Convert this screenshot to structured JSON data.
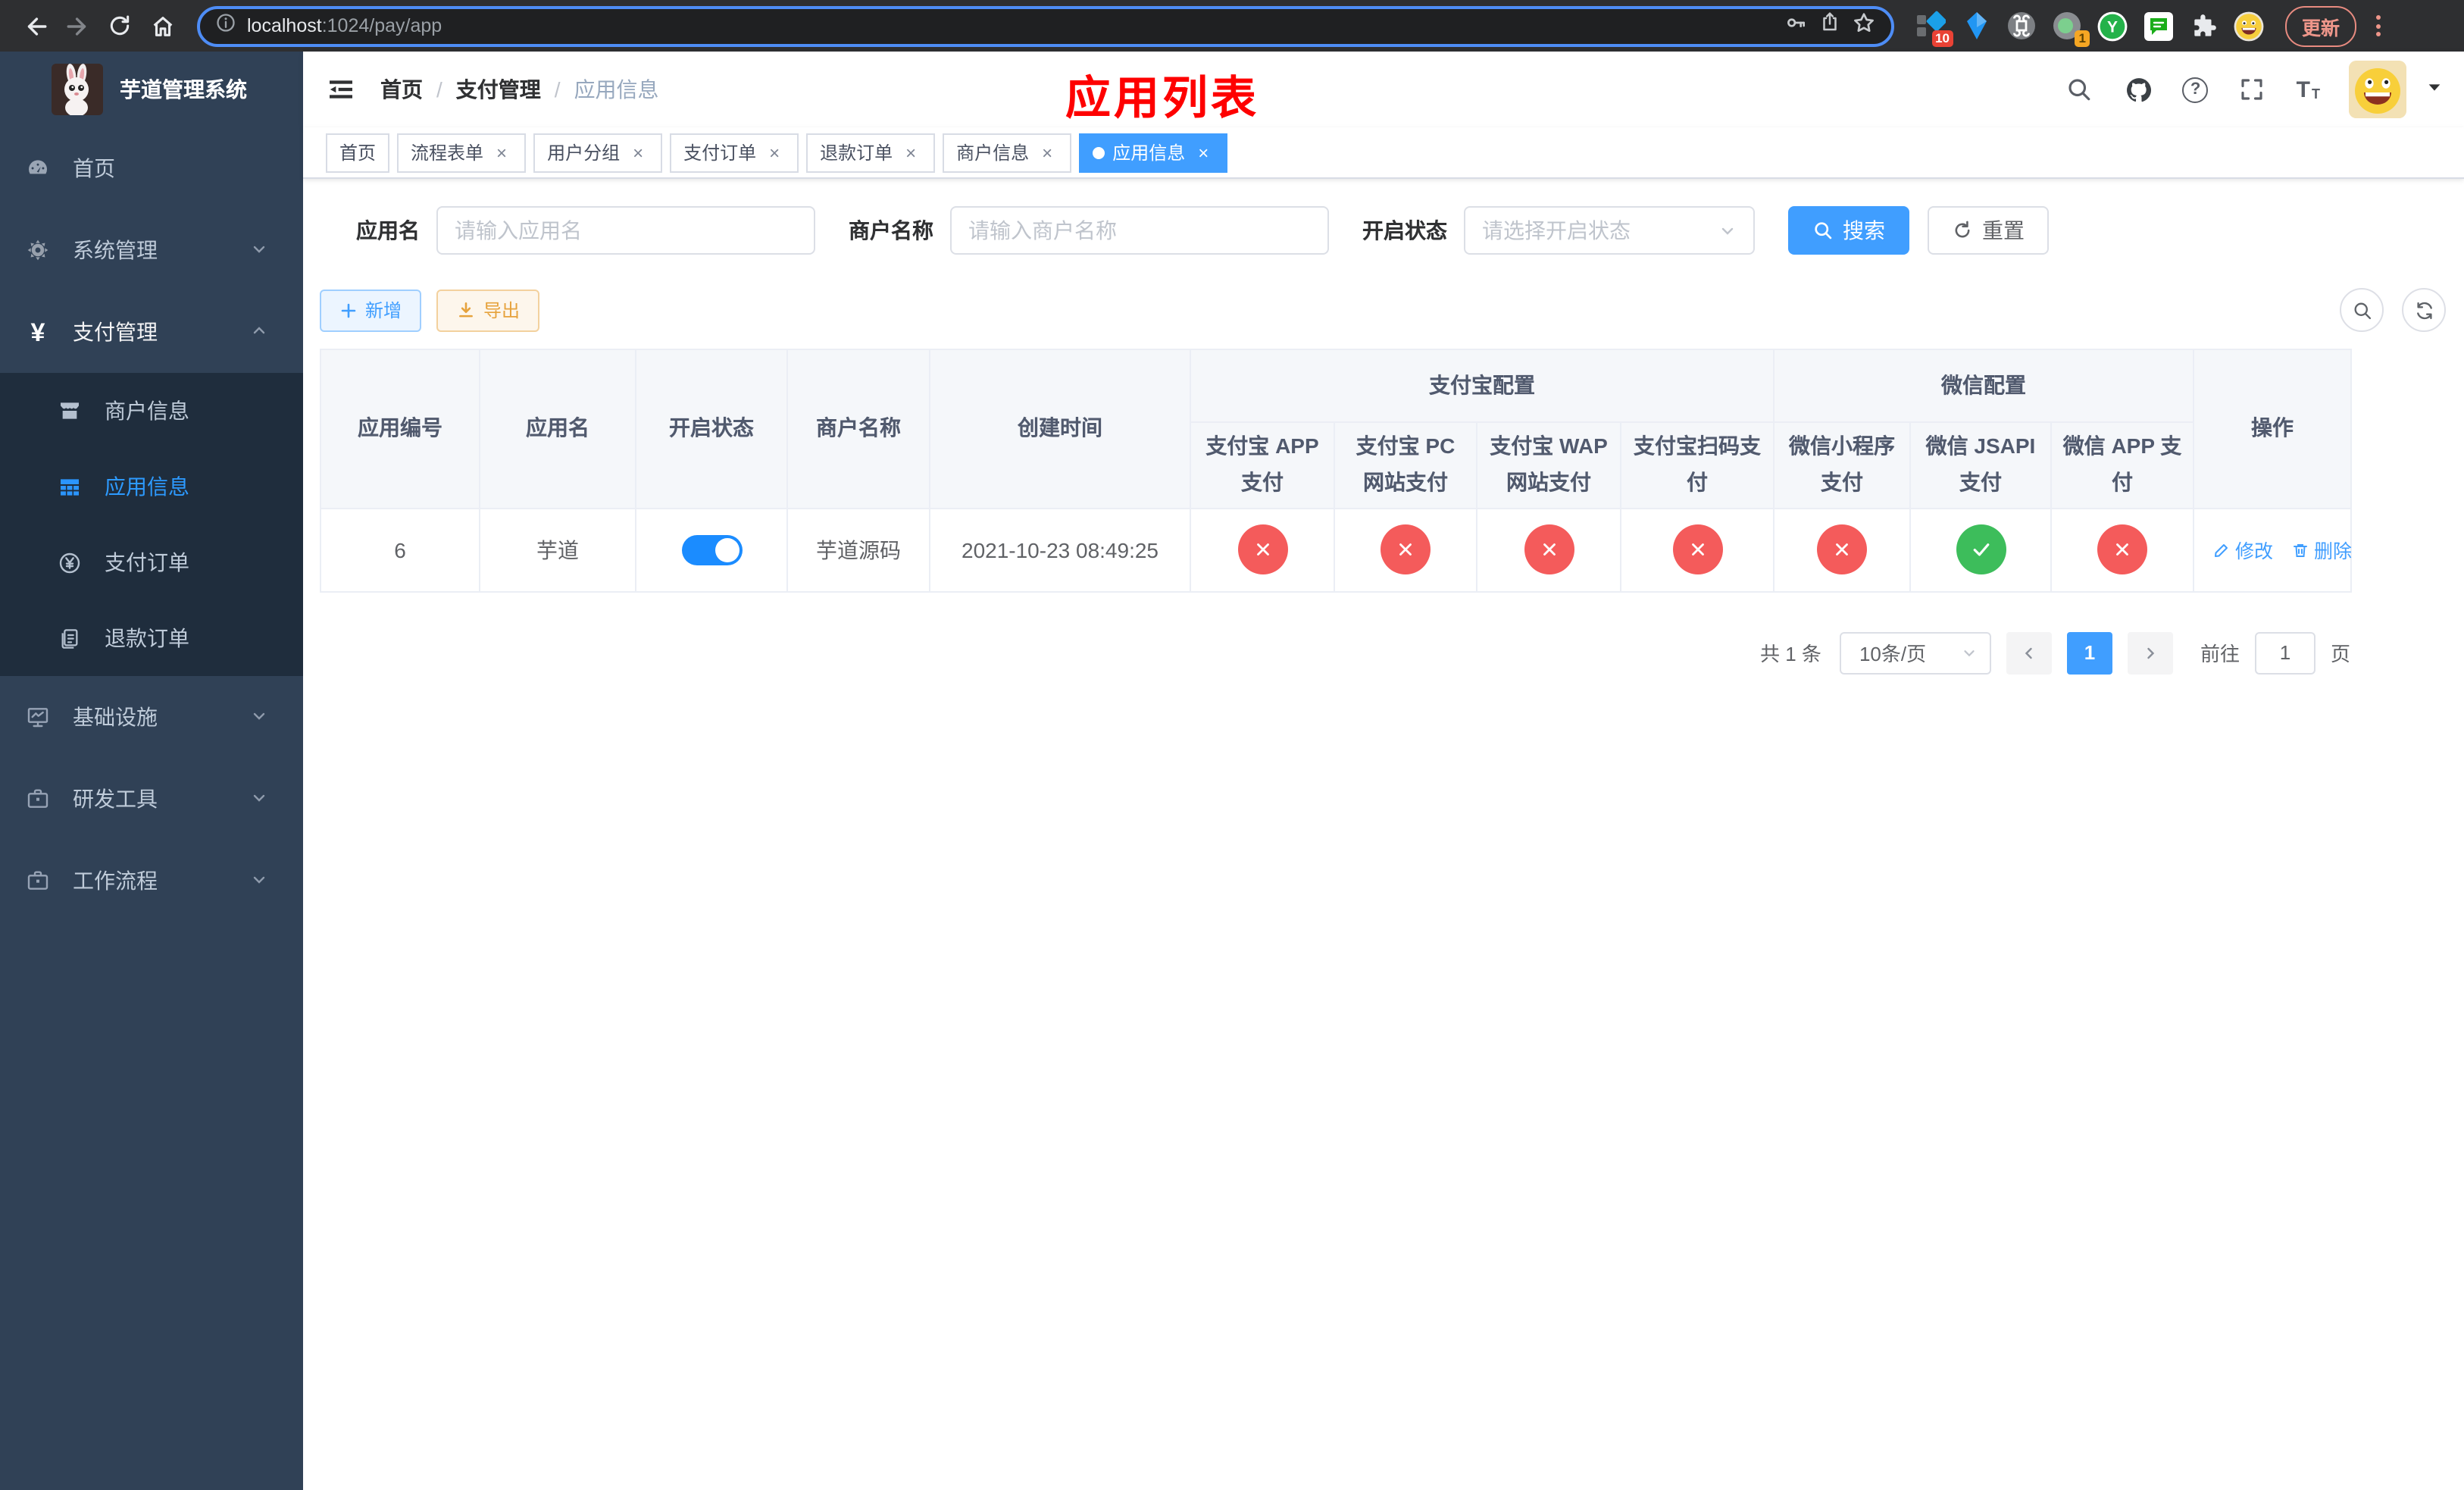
{
  "browser": {
    "url_host": "localhost",
    "url_rest": ":1024/pay/app",
    "update_label": "更新",
    "badges": {
      "tampermonkey": "10",
      "proxy": "1"
    }
  },
  "sidebar": {
    "title": "芋道管理系统",
    "menu": [
      {
        "label": "首页"
      },
      {
        "label": "系统管理"
      },
      {
        "label": "支付管理"
      },
      {
        "label": "基础设施"
      },
      {
        "label": "研发工具"
      },
      {
        "label": "工作流程"
      }
    ],
    "submenu": [
      {
        "label": "商户信息"
      },
      {
        "label": "应用信息"
      },
      {
        "label": "支付订单"
      },
      {
        "label": "退款订单"
      }
    ]
  },
  "navbar": {
    "breadcrumb": {
      "home": "首页",
      "sep": "/",
      "section": "支付管理",
      "current": "应用信息"
    }
  },
  "overlay_title": "应用列表",
  "tabs": [
    {
      "label": "首页"
    },
    {
      "label": "流程表单"
    },
    {
      "label": "用户分组"
    },
    {
      "label": "支付订单"
    },
    {
      "label": "退款订单"
    },
    {
      "label": "商户信息"
    },
    {
      "label": "应用信息"
    }
  ],
  "filters": {
    "app_name_label": "应用名",
    "app_name_placeholder": "请输入应用名",
    "merchant_label": "商户名称",
    "merchant_placeholder": "请输入商户名称",
    "status_label": "开启状态",
    "status_placeholder": "请选择开启状态",
    "search_label": "搜索",
    "reset_label": "重置"
  },
  "toolbar": {
    "add_label": "新增",
    "export_label": "导出"
  },
  "table": {
    "col_id": "应用编号",
    "col_name": "应用名",
    "col_status": "开启状态",
    "col_merchant": "商户名称",
    "col_created": "创建时间",
    "group_alipay": "支付宝配置",
    "group_wechat": "微信配置",
    "col_actions": "操作",
    "sub_cols": [
      "支付宝 APP 支付",
      "支付宝 PC 网站支付",
      "支付宝 WAP 网站支付",
      "支付宝扫码支付",
      "微信小程序支付",
      "微信 JSAPI 支付",
      "微信 APP 支付"
    ],
    "row": {
      "id": "6",
      "name": "芋道",
      "enabled": true,
      "merchant": "芋道源码",
      "created": "2021-10-23 08:49:25",
      "configs": [
        false,
        false,
        false,
        false,
        false,
        true,
        false
      ],
      "edit_label": "修改",
      "delete_label": "删除"
    }
  },
  "pagination": {
    "total": "共 1 条",
    "page_size": "10条/页",
    "current_page": "1",
    "goto_prefix": "前往",
    "goto_value": "1",
    "goto_suffix": "页"
  },
  "glyphs": {
    "close": "×",
    "plus": "+",
    "yen": "¥",
    "question": "?",
    "font": "T"
  },
  "colors": {
    "accent": "#409eff",
    "success": "#3dbd5b",
    "danger": "#f45b5b",
    "sidebar_bg": "#304156",
    "submenu_bg": "#1f2d3d"
  }
}
